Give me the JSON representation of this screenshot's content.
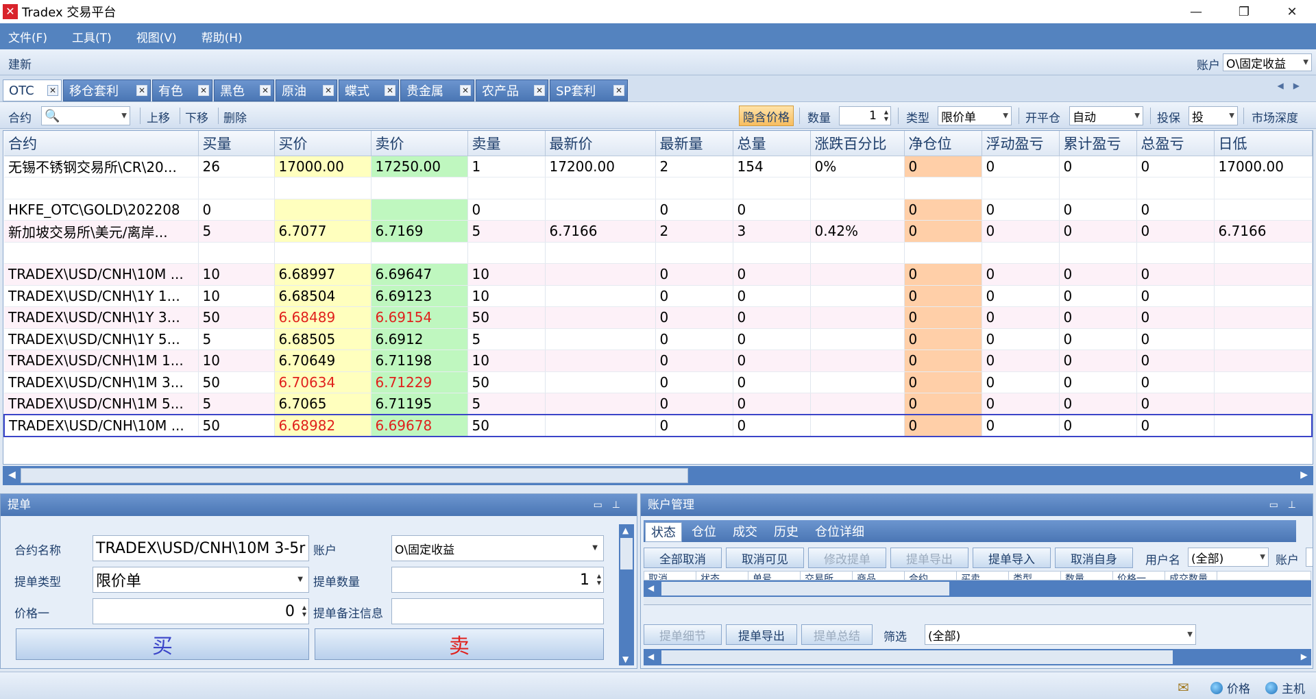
{
  "window": {
    "title": "Tradex 交易平台",
    "controls": [
      "—",
      "❐",
      "✕"
    ]
  },
  "menu": [
    "文件(F)",
    "工具(T)",
    "视图(V)",
    "帮助(H)"
  ],
  "new_bar": {
    "title": "建新",
    "account_label": "账户",
    "account_value": "O\\固定收益"
  },
  "tabs": [
    "OTC",
    "移仓套利",
    "有色",
    "黑色",
    "原油",
    "蝶式",
    "贵金属",
    "农产品",
    "SP套利"
  ],
  "toolbar": {
    "contract_label": "合约",
    "move_up": "上移",
    "move_down": "下移",
    "delete": "删除",
    "hide_price": "隐含价格",
    "qty_label": "数量",
    "qty_value": "1",
    "type_label": "类型",
    "type_value": "限价单",
    "open_close_label": "开平仓",
    "open_close_value": "自动",
    "hedge_label": "投保",
    "hedge_value": "投",
    "market_depth": "市场深度"
  },
  "grid": {
    "columns": [
      "合约",
      "买量",
      "买价",
      "卖价",
      "卖量",
      "最新价",
      "最新量",
      "总量",
      "涨跌百分比",
      "净仓位",
      "浮动盈亏",
      "累计盈亏",
      "总盈亏",
      "日低"
    ],
    "rows": [
      {
        "c": [
          "无锡不锈钢交易所\\CR\\20...",
          "26",
          "17000.00",
          "17250.00",
          "1",
          "17200.00",
          "2",
          "154",
          "0%",
          "0",
          "0",
          "0",
          "0",
          "17000.00"
        ],
        "pink": false,
        "red": false
      },
      {
        "c": [
          "",
          "",
          "",
          "",
          "",
          "",
          "",
          "",
          "",
          "",
          "",
          "",
          "",
          ""
        ],
        "pink": false,
        "red": false
      },
      {
        "c": [
          "HKFE_OTC\\GOLD\\202208",
          "0",
          "",
          "",
          "0",
          "",
          "0",
          "0",
          "",
          "0",
          "0",
          "0",
          "0",
          ""
        ],
        "pink": false,
        "red": false
      },
      {
        "c": [
          "新加坡交易所\\美元/离岸...",
          "5",
          "6.7077",
          "6.7169",
          "5",
          "6.7166",
          "2",
          "3",
          "0.42%",
          "0",
          "0",
          "0",
          "0",
          "6.7166"
        ],
        "pink": true,
        "red": false
      },
      {
        "c": [
          "",
          "",
          "",
          "",
          "",
          "",
          "",
          "",
          "",
          "",
          "",
          "",
          "",
          ""
        ],
        "pink": false,
        "red": false
      },
      {
        "c": [
          "TRADEX\\USD/CNH\\10M ...",
          "10",
          "6.68997",
          "6.69647",
          "10",
          "",
          "0",
          "0",
          "",
          "0",
          "0",
          "0",
          "0",
          ""
        ],
        "pink": true,
        "red": false
      },
      {
        "c": [
          "TRADEX\\USD/CNH\\1Y 1...",
          "10",
          "6.68504",
          "6.69123",
          "10",
          "",
          "0",
          "0",
          "",
          "0",
          "0",
          "0",
          "0",
          ""
        ],
        "pink": false,
        "red": false
      },
      {
        "c": [
          "TRADEX\\USD/CNH\\1Y 3...",
          "50",
          "6.68489",
          "6.69154",
          "50",
          "",
          "0",
          "0",
          "",
          "0",
          "0",
          "0",
          "0",
          ""
        ],
        "pink": true,
        "red": true
      },
      {
        "c": [
          "TRADEX\\USD/CNH\\1Y 5...",
          "5",
          "6.68505",
          "6.6912",
          "5",
          "",
          "0",
          "0",
          "",
          "0",
          "0",
          "0",
          "0",
          ""
        ],
        "pink": false,
        "red": false
      },
      {
        "c": [
          "TRADEX\\USD/CNH\\1M 1...",
          "10",
          "6.70649",
          "6.71198",
          "10",
          "",
          "0",
          "0",
          "",
          "0",
          "0",
          "0",
          "0",
          ""
        ],
        "pink": true,
        "red": false
      },
      {
        "c": [
          "TRADEX\\USD/CNH\\1M 3...",
          "50",
          "6.70634",
          "6.71229",
          "50",
          "",
          "0",
          "0",
          "",
          "0",
          "0",
          "0",
          "0",
          ""
        ],
        "pink": false,
        "red": true
      },
      {
        "c": [
          "TRADEX\\USD/CNH\\1M 5...",
          "5",
          "6.7065",
          "6.71195",
          "5",
          "",
          "0",
          "0",
          "",
          "0",
          "0",
          "0",
          "0",
          ""
        ],
        "pink": true,
        "red": false
      },
      {
        "c": [
          "TRADEX\\USD/CNH\\10M ...",
          "50",
          "6.68982",
          "6.69678",
          "50",
          "",
          "0",
          "0",
          "",
          "0",
          "0",
          "0",
          "0",
          ""
        ],
        "pink": false,
        "red": true,
        "selected": true
      }
    ]
  },
  "order_panel": {
    "title": "提单",
    "contract_name_label": "合约名称",
    "contract_name_value": "TRADEX\\USD/CNH\\10M 3-5r",
    "account_label": "账户",
    "account_value": "O\\固定收益",
    "order_type_label": "提单类型",
    "order_type_value": "限价单",
    "order_qty_label": "提单数量",
    "order_qty_value": "1",
    "price_label": "价格一",
    "price_value": "0",
    "note_label": "提单备注信息",
    "note_value": "",
    "buy_label": "买",
    "sell_label": "卖"
  },
  "account_panel": {
    "title": "账户管理",
    "tabs": [
      "状态",
      "仓位",
      "成交",
      "历史",
      "仓位详细"
    ],
    "buttons": [
      "全部取消",
      "取消可见",
      "修改提单",
      "提单导出",
      "提单导入",
      "取消自身"
    ],
    "username_label": "用户名",
    "username_value": "(全部)",
    "account_label": "账户",
    "columns_partial": [
      "取消",
      "状态",
      "单号",
      "交易所",
      "商品",
      "合约",
      "买卖",
      "类型",
      "数量",
      "价格一",
      "成交数量"
    ],
    "bottom_buttons": [
      "提单细节",
      "提单导出",
      "提单总结"
    ],
    "filter_label": "筛选",
    "filter_value": "(全部)"
  },
  "status_bar": {
    "price": "价格",
    "host": "主机"
  },
  "colors": {
    "accent": "#5483bf",
    "buy_cell": "#ffffbe",
    "sell_cell": "#bff7bf",
    "net_cell": "#ffcfa8",
    "red_text": "#e0201c"
  }
}
